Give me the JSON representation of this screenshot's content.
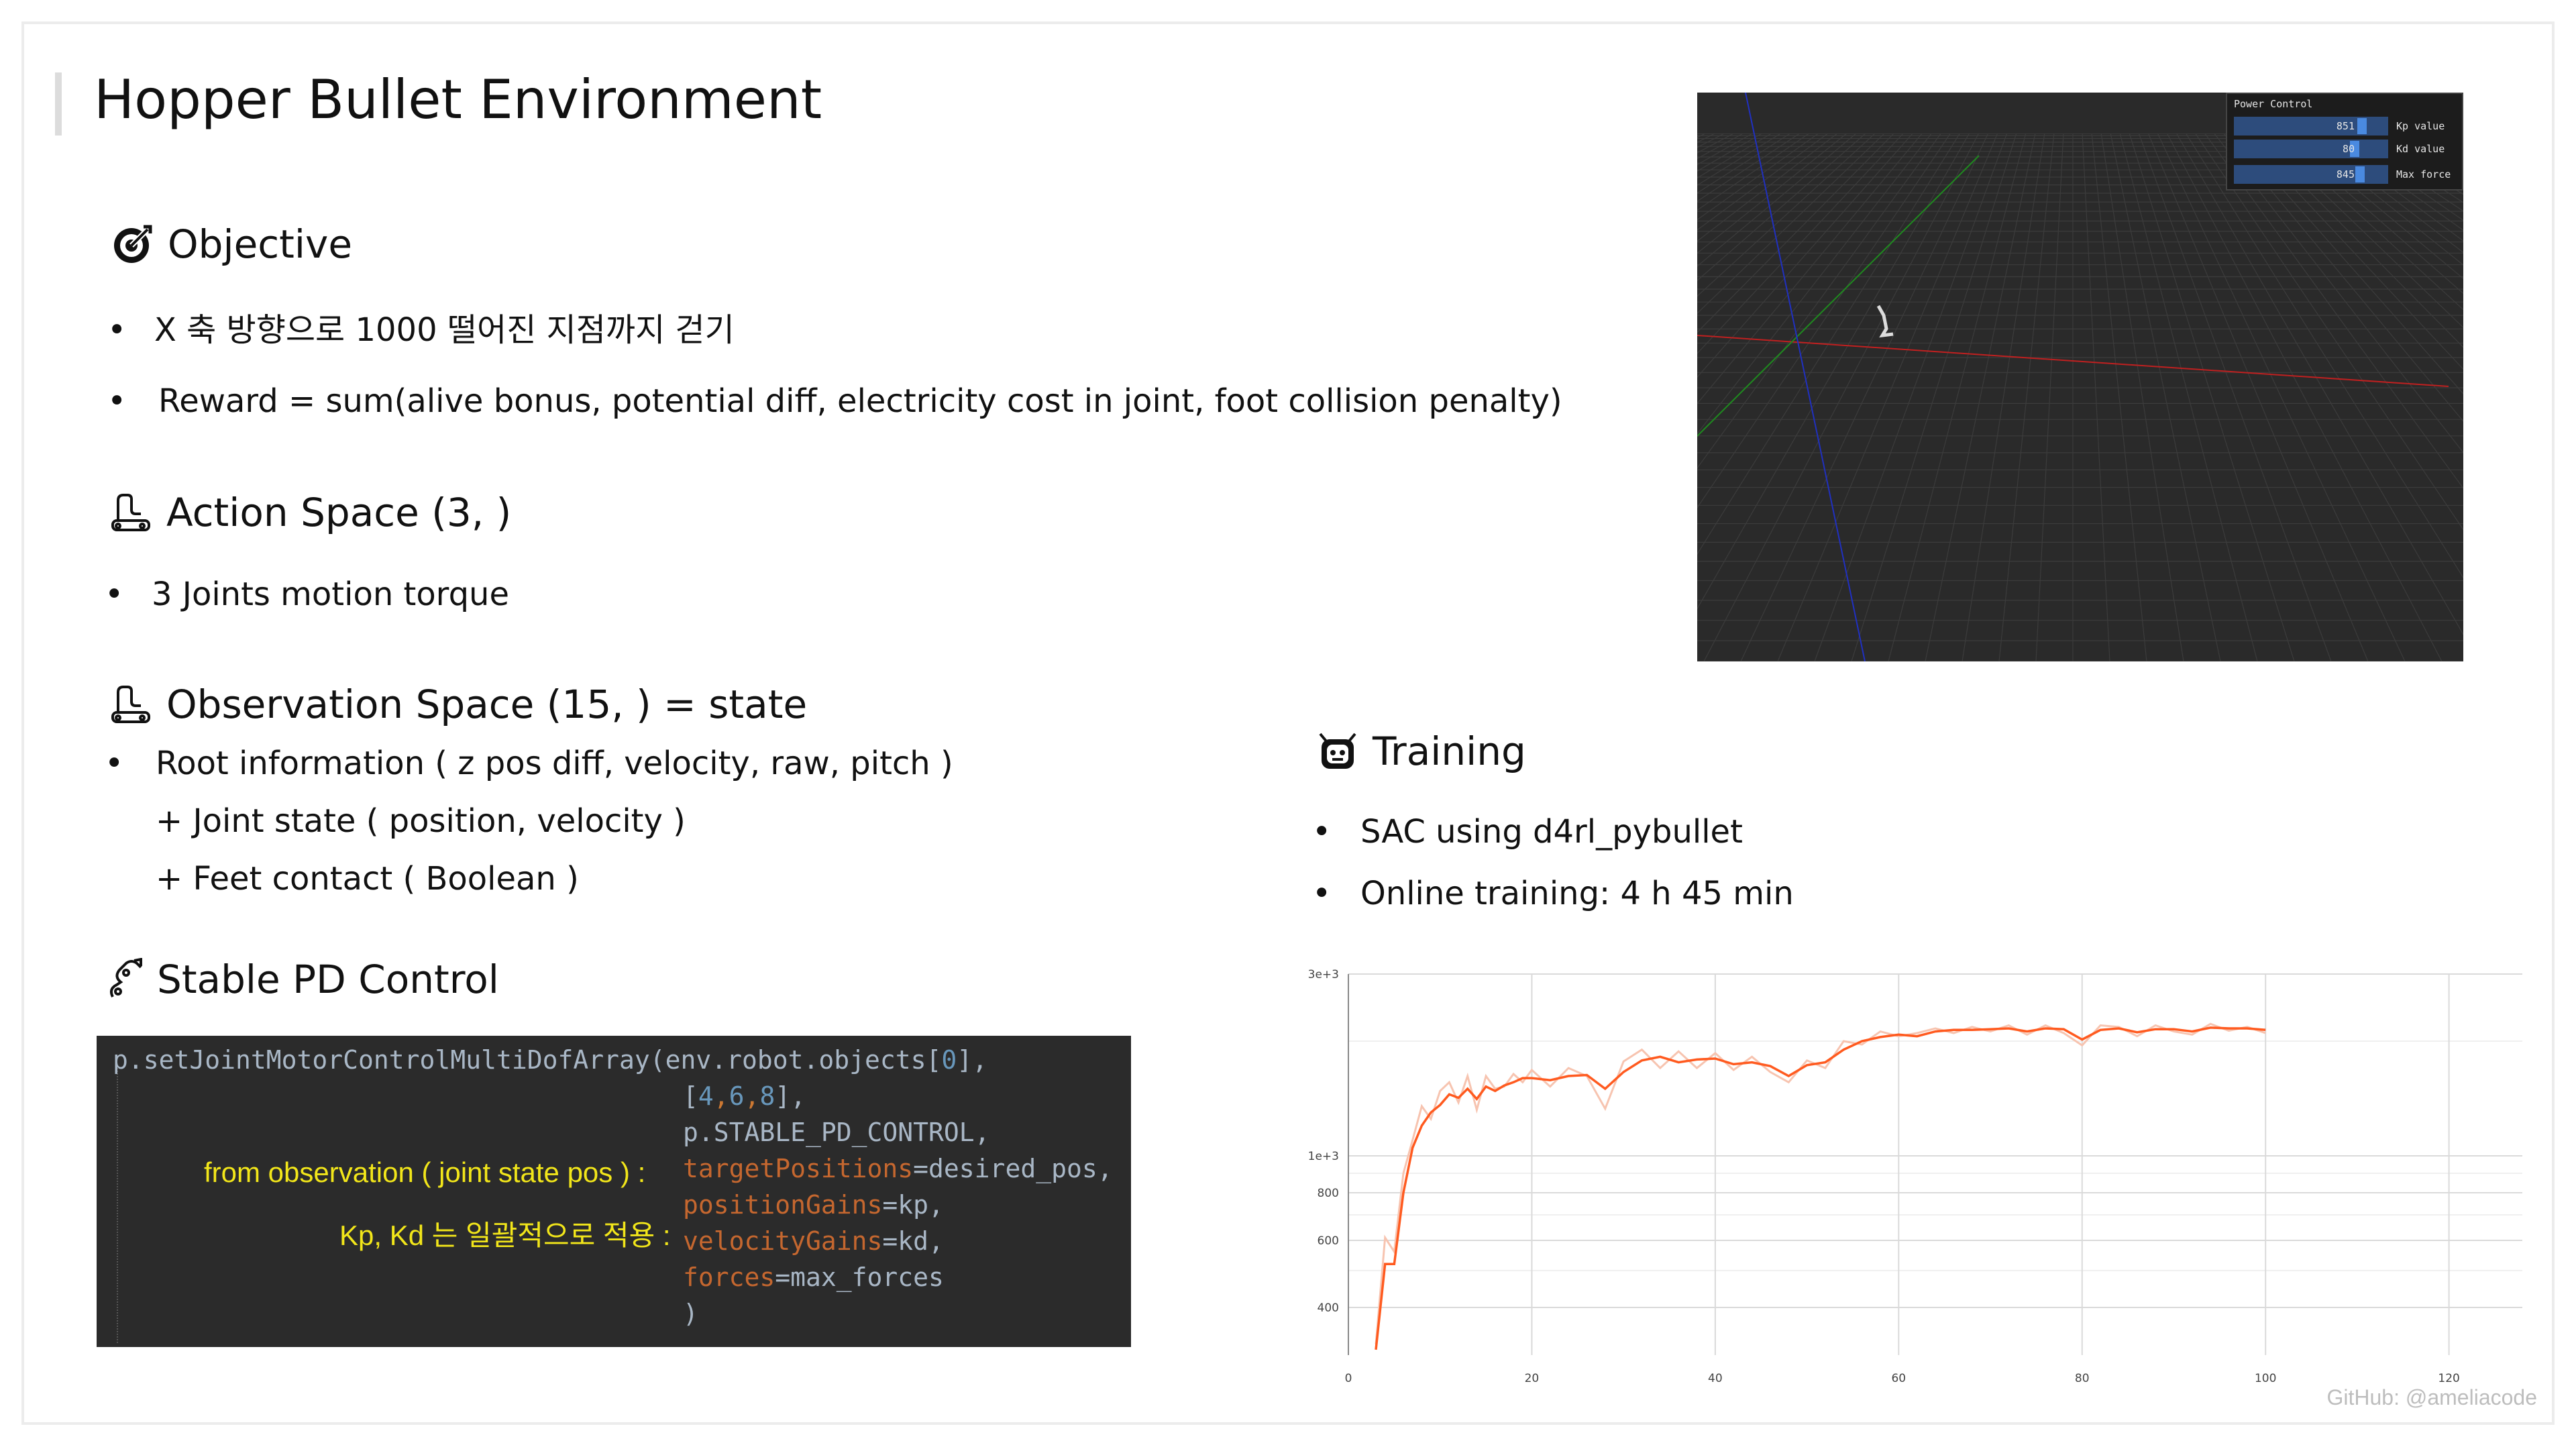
{
  "title": "Hopper Bullet Environment",
  "objective": {
    "heading": "Objective",
    "icon": "target-icon",
    "bullets": [
      "X 축 방향으로 1000 떨어진 지점까지 걷기",
      "Reward = sum(alive bonus, potential diff, electricity cost in joint, foot collision penalty)"
    ]
  },
  "action_space": {
    "heading": "Action Space (3, )",
    "icon": "robot-arm-icon",
    "bullets": [
      "3 Joints motion torque"
    ]
  },
  "observation_space": {
    "heading": "Observation Space (15, ) = state",
    "icon": "robot-arm-icon",
    "bullets": [
      "Root information ( z pos diff, velocity, raw, pitch )"
    ],
    "continuation": [
      "+ Joint state ( position, velocity )",
      "+ Feet contact ( Boolean )"
    ]
  },
  "stable_pd": {
    "heading": "Stable PD Control",
    "icon": "mechanical-arm-icon",
    "code": {
      "line1_fn": "p.setJointMotorControlMultiDofArray(",
      "line1_arg": "env.robot.objects[",
      "line1_idx": "0",
      "line1_end": "],",
      "line2_open": "[",
      "line2_a": "4",
      "line2_b": "6",
      "line2_c": "8",
      "line2_end": "],",
      "line3": "p.STABLE_PD_CONTROL,",
      "line4_key": "targetPositions",
      "line4_val": "=desired_pos,",
      "line5_key": "positionGains",
      "line5_val": "=kp,",
      "line6_key": "velocityGains",
      "line6_val": "=kd,",
      "line7_key": "forces",
      "line7_val": "=max_forces",
      "line8": ")"
    },
    "annotations": {
      "target": "from observation ( joint state pos ) :",
      "gains": "Kp, Kd 는 일괄적으로 적용 :"
    }
  },
  "viewer": {
    "panel_title": "Power Control",
    "sliders": [
      {
        "value": "851",
        "label": "Kp value",
        "fraction": 0.85
      },
      {
        "value": "80",
        "label": "Kd value",
        "fraction": 0.8
      },
      {
        "value": "845",
        "label": "Max force",
        "fraction": 0.84
      }
    ],
    "colors": {
      "background": "#2a2a2a",
      "grid": "#3c3c3c",
      "x_axis": "#c02020",
      "y_axis": "#1f8a1f",
      "z_axis": "#2030c0"
    }
  },
  "training": {
    "heading": "Training",
    "icon": "robot-face-icon",
    "bullets": [
      "SAC using d4rl_pybullet",
      "Online training: 4 h 45 min"
    ]
  },
  "chart_data": {
    "type": "line",
    "title": "",
    "xlabel": "",
    "ylabel": "",
    "x_ticks": [
      0,
      20,
      40,
      60,
      80,
      100,
      120
    ],
    "y_tick_labels": [
      "3e+3",
      "1e+3",
      "800",
      "600",
      "400"
    ],
    "y_ticks": [
      3000,
      1000,
      800,
      600,
      400
    ],
    "yscale": "log",
    "xlim": [
      0,
      128
    ],
    "ylim": [
      300,
      3000
    ],
    "grid": true,
    "series": [
      {
        "color": "#ff5a1f",
        "x": [
          3,
          4,
          5,
          6,
          7,
          8,
          9,
          10,
          11,
          12,
          13,
          14,
          15,
          16,
          17,
          18,
          19,
          20,
          22,
          24,
          26,
          28,
          30,
          32,
          34,
          36,
          38,
          40,
          42,
          44,
          46,
          48,
          50,
          52,
          54,
          56,
          58,
          60,
          62,
          64,
          66,
          68,
          70,
          72,
          74,
          76,
          78,
          80,
          82,
          84,
          86,
          88,
          90,
          92,
          94,
          96,
          98,
          100
        ],
        "y": [
          310,
          520,
          520,
          800,
          1050,
          1200,
          1300,
          1360,
          1450,
          1420,
          1500,
          1410,
          1520,
          1480,
          1530,
          1560,
          1600,
          1600,
          1580,
          1620,
          1630,
          1500,
          1660,
          1780,
          1820,
          1760,
          1790,
          1800,
          1740,
          1760,
          1720,
          1620,
          1730,
          1760,
          1900,
          2000,
          2050,
          2080,
          2060,
          2120,
          2140,
          2140,
          2150,
          2160,
          2120,
          2160,
          2150,
          2020,
          2140,
          2160,
          2110,
          2150,
          2150,
          2120,
          2170,
          2160,
          2160,
          2140
        ]
      },
      {
        "color": "#f7c4b0",
        "x": [
          3,
          4,
          5,
          6,
          7,
          8,
          9,
          10,
          11,
          12,
          13,
          14,
          15,
          16,
          17,
          18,
          19,
          20,
          22,
          24,
          26,
          28,
          30,
          32,
          34,
          36,
          38,
          40,
          42,
          44,
          46,
          48,
          50,
          52,
          54,
          56,
          58,
          60,
          62,
          64,
          66,
          68,
          70,
          72,
          74,
          76,
          78,
          80,
          82,
          84,
          86,
          88,
          90,
          92,
          94,
          96,
          98,
          100
        ],
        "y": [
          320,
          610,
          560,
          900,
          1100,
          1350,
          1250,
          1480,
          1560,
          1380,
          1620,
          1320,
          1620,
          1500,
          1520,
          1640,
          1560,
          1680,
          1520,
          1700,
          1620,
          1330,
          1770,
          1900,
          1700,
          1880,
          1700,
          1860,
          1680,
          1820,
          1660,
          1560,
          1780,
          1700,
          2000,
          1960,
          2120,
          2060,
          2100,
          2160,
          2100,
          2180,
          2120,
          2200,
          2080,
          2200,
          2100,
          1950,
          2200,
          2180,
          2060,
          2200,
          2120,
          2080,
          2220,
          2130,
          2180,
          2100
        ]
      }
    ]
  },
  "footer": "GitHub: @ameliacode"
}
